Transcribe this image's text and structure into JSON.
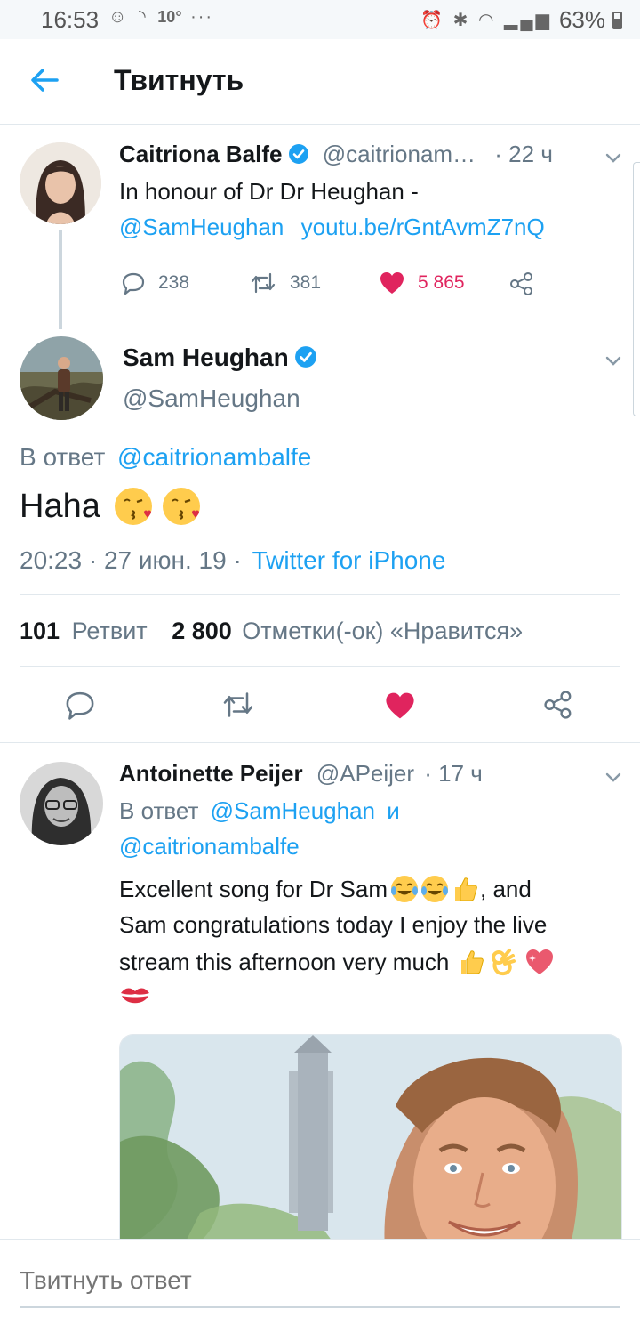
{
  "status_bar": {
    "time": "16:53",
    "temperature": "10°",
    "battery": "63%",
    "icon_names": [
      "notification-icon",
      "hotspot-icon",
      "more-icon",
      "alarm-icon",
      "bluetooth-icon",
      "wifi-icon",
      "signal-icon",
      "battery-icon"
    ]
  },
  "appbar": {
    "title": "Твитнуть"
  },
  "parent_tweet": {
    "name": "Caitriona Balfe",
    "handle": "@caitrionam…",
    "time": "· 22 ч",
    "text_line1": "In honour of Dr Dr Heughan -",
    "mention": "@SamHeughan",
    "link": "youtu.be/rGntAvmZ7nQ",
    "replies": "238",
    "retweets": "381",
    "likes": "5 865"
  },
  "main_tweet": {
    "name": "Sam Heughan",
    "handle": "@SamHeughan",
    "reply_prefix": "В ответ",
    "reply_to": "@caitrionambalfe",
    "text": "Haha",
    "timestamp": "20:23 · 27 июн. 19 ·",
    "source": "Twitter for iPhone",
    "retweet_count": "101",
    "retweet_label": "Ретвит",
    "like_count": "2 800",
    "like_label": "Отметки(-ок) «Нравится»"
  },
  "reply_tweet": {
    "name": "Antoinette Peijer",
    "handle": "@APeijer",
    "time": "· 17 ч",
    "reply_prefix": "В ответ",
    "reply_to_1": "@SamHeughan",
    "reply_and": "и",
    "reply_to_2": "@caitrionambalfe",
    "text_line1": "Excellent song for Dr Sam",
    "text_line1_end": ", and",
    "text_line2": "Sam congratulations today I enjoy the live",
    "text_line3": "stream this afternoon very much"
  },
  "compose": {
    "placeholder": "Твитнуть ответ"
  },
  "colors": {
    "accent": "#1da1f2",
    "like": "#e0245e",
    "secondary_text": "#657786",
    "divider": "#e1e8ed"
  }
}
